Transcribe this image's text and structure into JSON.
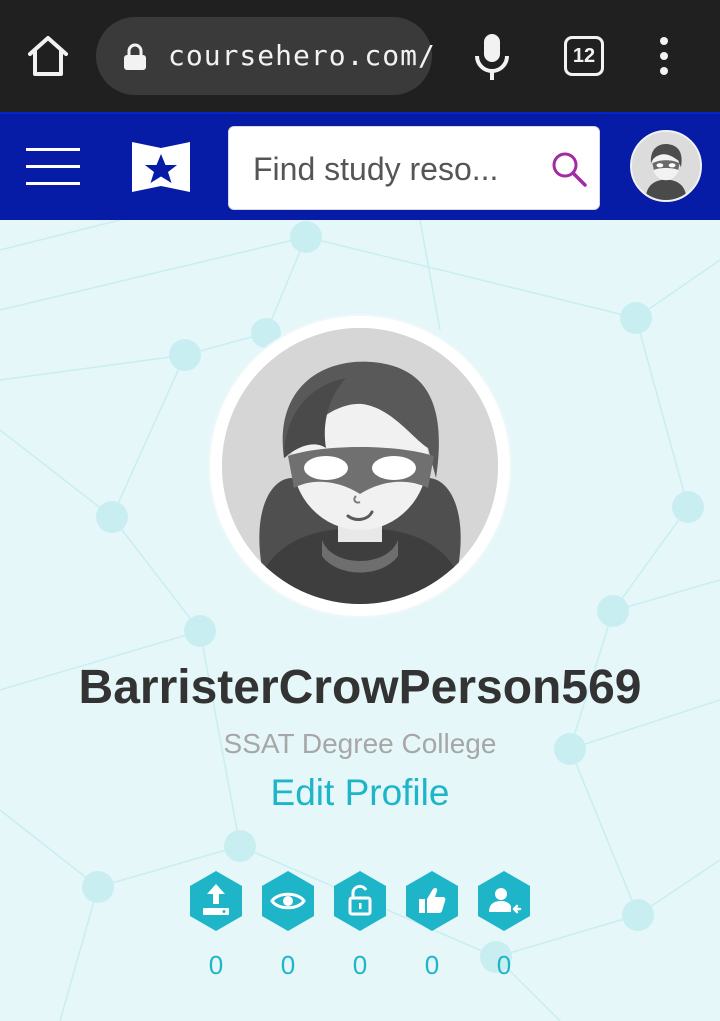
{
  "browser": {
    "url": "coursehero.com/",
    "tab_count": "12",
    "icons": [
      "home-icon",
      "lock-icon",
      "mic-icon",
      "tabs-icon",
      "more-vert-icon"
    ]
  },
  "header": {
    "search_placeholder": "Find study reso...",
    "colors": {
      "bar": "#061ba6",
      "search_icon": "#a32aa6"
    }
  },
  "profile": {
    "username": "BarristerCrowPerson569",
    "school": "SSAT Degree College",
    "edit_label": "Edit Profile"
  },
  "stats": [
    {
      "icon": "upload-icon",
      "value": "0"
    },
    {
      "icon": "eye-icon",
      "value": "0"
    },
    {
      "icon": "unlock-icon",
      "value": "0"
    },
    {
      "icon": "thumbs-up-icon",
      "value": "0"
    },
    {
      "icon": "user-follow-icon",
      "value": "0"
    }
  ],
  "colors": {
    "accent": "#1fb5c9",
    "background": "#e6f7f9",
    "text": "#333333",
    "muted": "#a7a7a7"
  }
}
